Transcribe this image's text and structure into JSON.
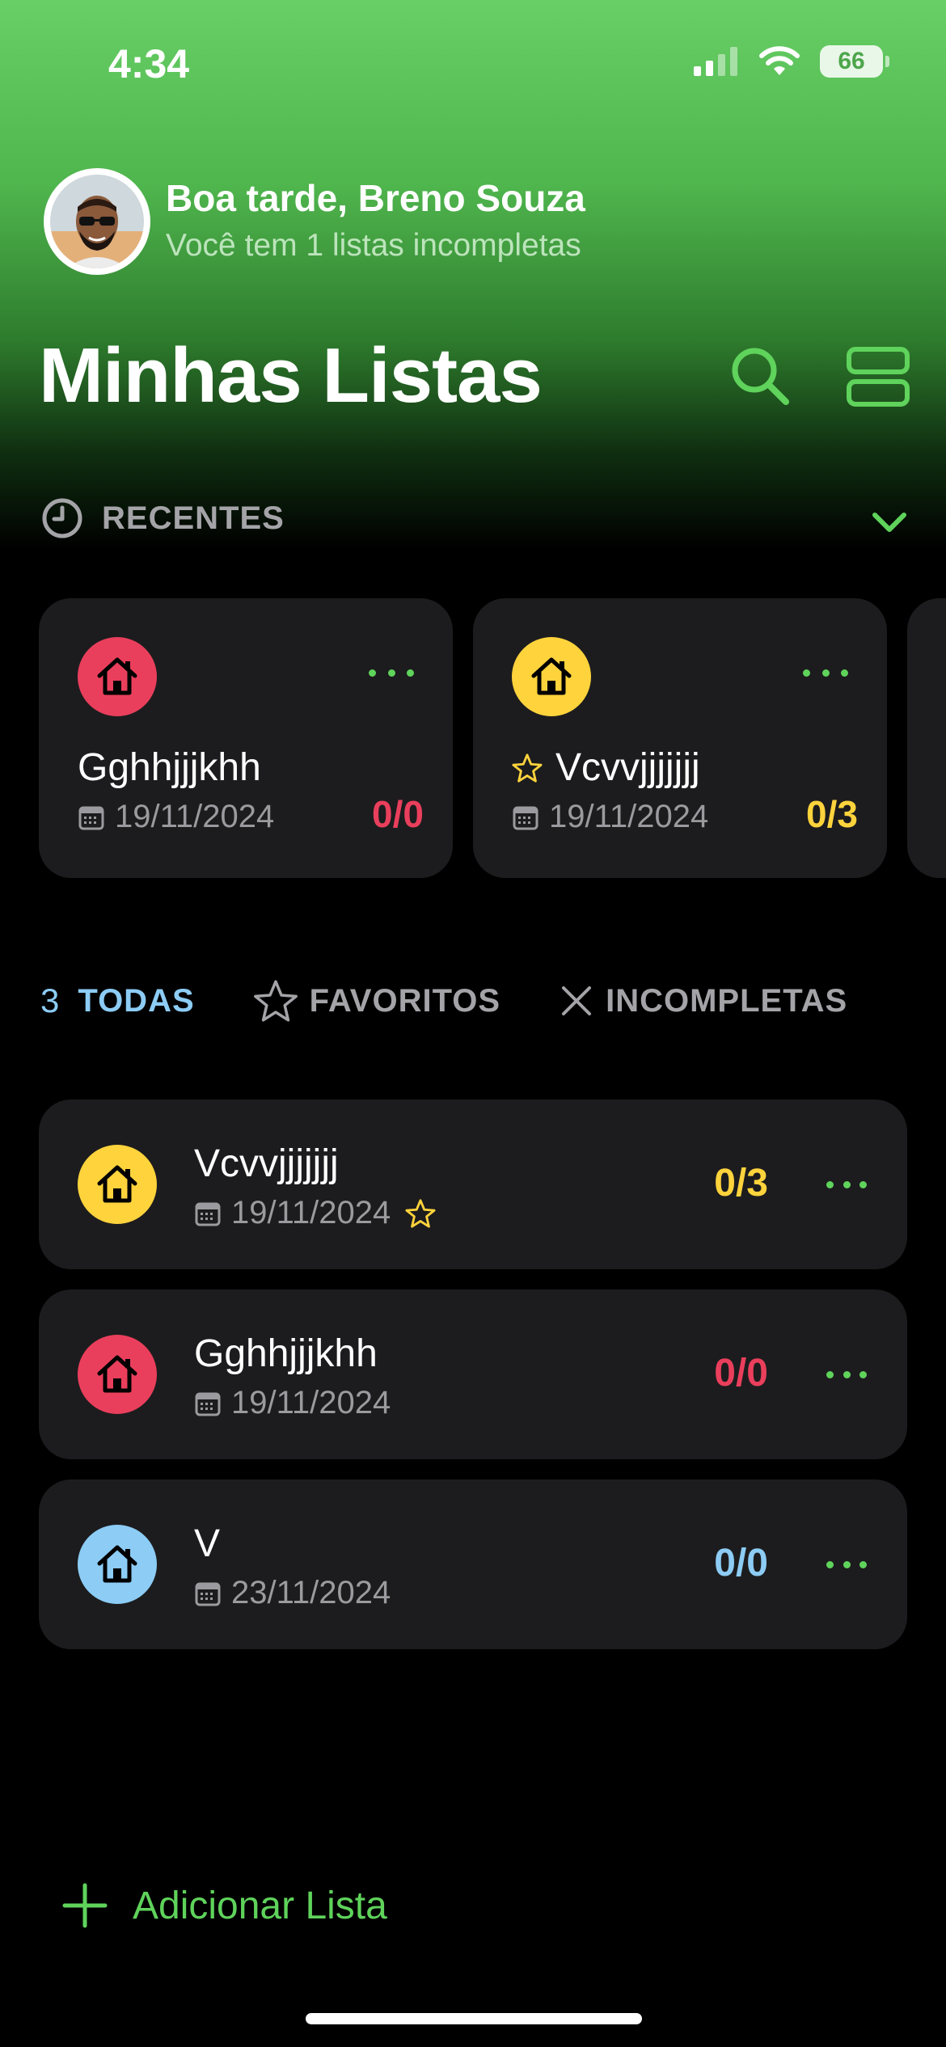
{
  "status": {
    "time": "4:34",
    "battery": "66"
  },
  "header": {
    "greeting": "Boa tarde, Breno Souza",
    "subtitle": "Você tem 1 listas incompletas",
    "title": "Minhas Listas"
  },
  "recent": {
    "label": "RECENTES",
    "cards": [
      {
        "name": "Gghhjjjkhh",
        "date": "19/11/2024",
        "count": "0/0",
        "color": "#ea3f5c",
        "favorite": false
      },
      {
        "name": "Vcvvjjjjjjj",
        "date": "19/11/2024",
        "count": "0/3",
        "color": "#ffd33c",
        "favorite": true
      }
    ]
  },
  "tabs": {
    "all_count": "3",
    "all_label": "TODAS",
    "favorites_label": "FAVORITOS",
    "incomplete_label": "INCOMPLETAS"
  },
  "lists": [
    {
      "name": "Vcvvjjjjjjj",
      "date": "19/11/2024",
      "count": "0/3",
      "color": "#ffd33c",
      "favorite": true
    },
    {
      "name": "Gghhjjjkhh",
      "date": "19/11/2024",
      "count": "0/0",
      "color": "#ea3f5c",
      "favorite": false
    },
    {
      "name": "V",
      "date": "23/11/2024",
      "count": "0/0",
      "color": "#8cccf5",
      "favorite": false
    }
  ],
  "add": {
    "label": "Adicionar Lista"
  },
  "colors": {
    "accent": "#5fd35b",
    "red": "#ea3f5c",
    "yellow": "#ffd33c",
    "blue": "#8cccf5"
  }
}
